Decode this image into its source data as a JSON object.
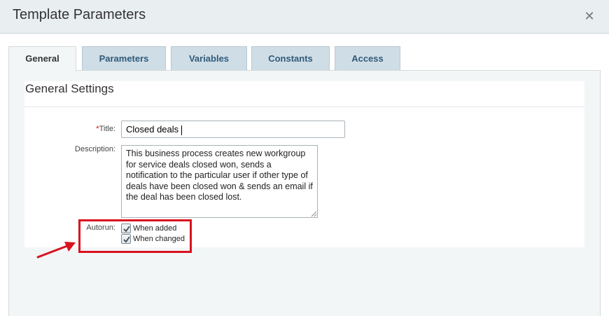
{
  "dialog": {
    "title": "Template Parameters",
    "close_icon": "close-icon"
  },
  "tabs": [
    {
      "label": "General",
      "active": true
    },
    {
      "label": "Parameters",
      "active": false
    },
    {
      "label": "Variables",
      "active": false
    },
    {
      "label": "Constants",
      "active": false
    },
    {
      "label": "Access",
      "active": false
    }
  ],
  "general": {
    "section_title": "General Settings",
    "title_label": "Title:",
    "title_required_mark": "*",
    "title_value": "Closed deals",
    "description_label": "Description:",
    "description_value": "This business process creates new workgroup for service deals closed won, sends a notification to the particular user if other type of deals have been closed won & sends an email if the deal has been closed lost.",
    "autorun_label": "Autorun:",
    "autorun_options": [
      {
        "label": "When added",
        "checked": true
      },
      {
        "label": "When changed",
        "checked": true
      }
    ]
  },
  "colors": {
    "highlight": "#d9121e",
    "tab_inactive_bg": "#cfdde6",
    "tab_text": "#2f5a7a",
    "header_bg": "#e9eef0"
  }
}
